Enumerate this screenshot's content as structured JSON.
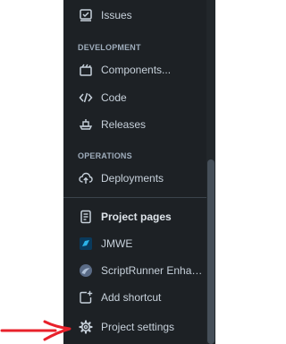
{
  "sidebar": {
    "items": [
      {
        "label": "Issues",
        "icon": "issues-icon"
      },
      {
        "label": "Components...",
        "icon": "components-icon"
      },
      {
        "label": "Code",
        "icon": "code-icon"
      },
      {
        "label": "Releases",
        "icon": "releases-icon"
      },
      {
        "label": "Deployments",
        "icon": "deployments-icon"
      },
      {
        "label": "Project pages",
        "icon": "project-pages-icon"
      },
      {
        "label": "JMWE",
        "icon": "jmwe-app-icon"
      },
      {
        "label": "ScriptRunner Enhanc...",
        "icon": "scriptrunner-app-icon"
      },
      {
        "label": "Add shortcut",
        "icon": "add-shortcut-icon"
      },
      {
        "label": "Project settings",
        "icon": "gear-icon"
      }
    ],
    "sections": {
      "development": "DEVELOPMENT",
      "operations": "OPERATIONS"
    }
  },
  "annotation": {
    "arrow_color": "#e8212b"
  }
}
